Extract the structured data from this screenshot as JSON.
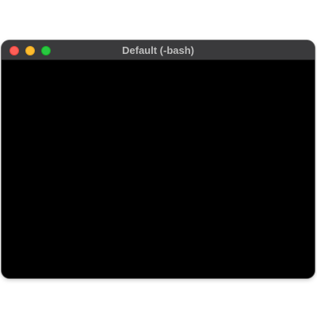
{
  "window": {
    "title": "Default (-bash)",
    "controls": {
      "close": "close-button",
      "minimize": "minimize-button",
      "zoom": "zoom-button"
    }
  },
  "colors": {
    "titlebar": "#3a3a3c",
    "terminal_background": "#000000",
    "close": "#ff5f57",
    "minimize": "#febc2e",
    "zoom": "#28c840"
  }
}
